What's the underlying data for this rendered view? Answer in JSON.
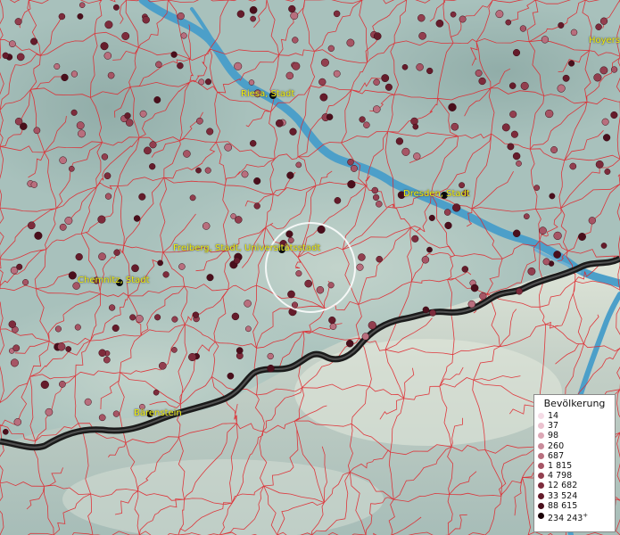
{
  "map": {
    "cities": [
      {
        "name": "Riesa, Stadt"
      },
      {
        "name": "Dresden, Stadt"
      },
      {
        "name": "Freiberg, Stadt, Universitätsstadt"
      },
      {
        "name": "Chemnitz, Stadt"
      },
      {
        "name": "Bärenstein"
      },
      {
        "name": "Hoyers"
      }
    ]
  },
  "legend": {
    "title": "Bevölkerung",
    "entries": [
      {
        "label": "14",
        "color": "#f5dce6"
      },
      {
        "label": "37",
        "color": "#ebc2cf"
      },
      {
        "label": "98",
        "color": "#dca7b5"
      },
      {
        "label": "260",
        "color": "#c98b9a"
      },
      {
        "label": "687",
        "color": "#b86f7e"
      },
      {
        "label": "1 815",
        "color": "#a65565"
      },
      {
        "label": "4 798",
        "color": "#923f4f"
      },
      {
        "label": "12 682",
        "color": "#7d2c3c"
      },
      {
        "label": "33 524",
        "color": "#651c2b"
      },
      {
        "label": "88 615",
        "color": "#4a0f1c"
      },
      {
        "label": "234 243",
        "color": "#1a0006",
        "suffix": "+"
      }
    ]
  },
  "colors": {
    "boundary": "#e0262c",
    "river": "#4c9fc9",
    "border": "#1a1a1a",
    "label": "#f2f20a"
  }
}
